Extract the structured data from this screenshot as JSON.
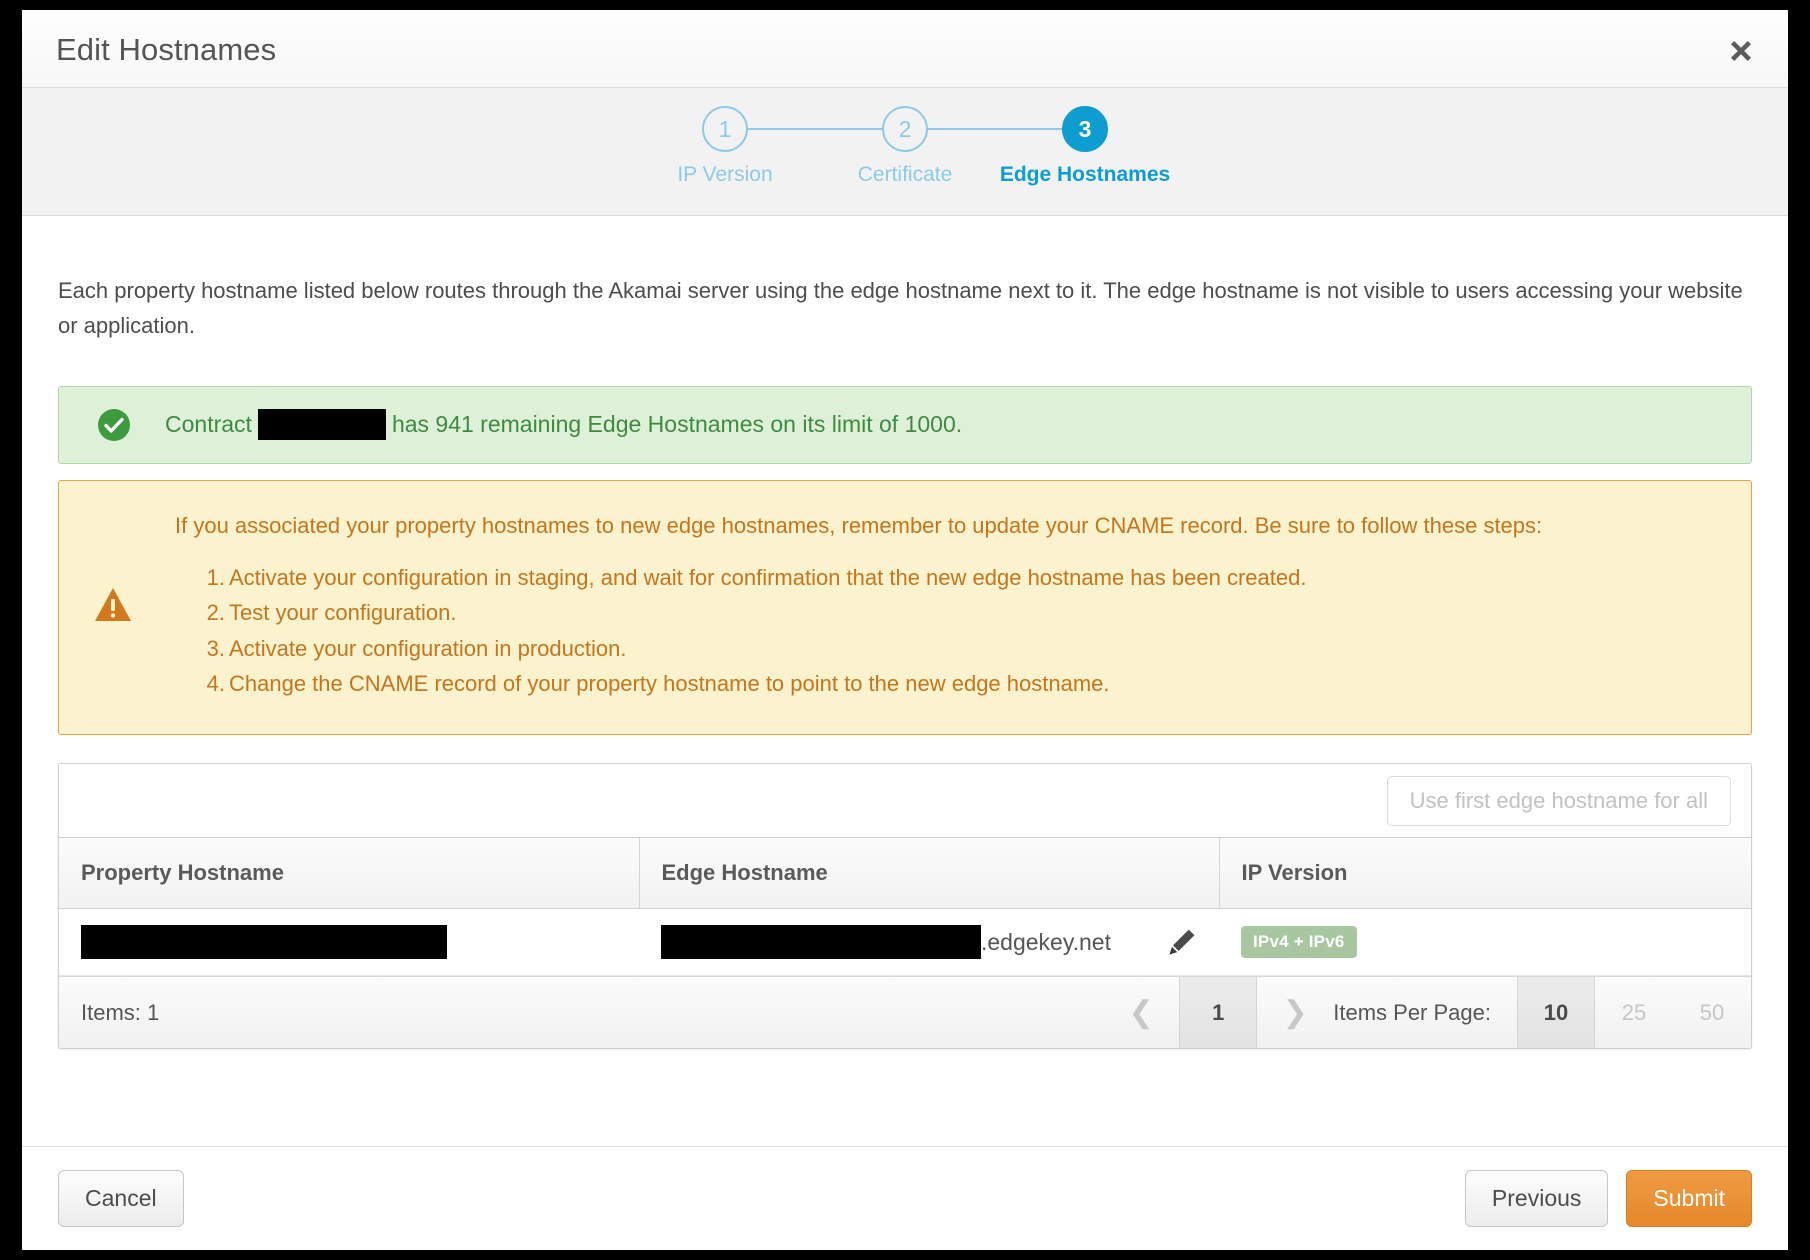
{
  "window": {
    "title": "Edit Hostnames",
    "close_icon": "close-icon"
  },
  "stepper": {
    "steps": [
      {
        "number": "1",
        "label": "IP Version",
        "state": "pending"
      },
      {
        "number": "2",
        "label": "Certificate",
        "state": "pending"
      },
      {
        "number": "3",
        "label": "Edge Hostnames",
        "state": "active"
      }
    ],
    "accent_active": "#0d9dd1",
    "accent_pending": "#8ecae6"
  },
  "main": {
    "intro": "Each property hostname listed below routes through the Akamai server using the edge hostname next to it. The edge hostname is not visible to users accessing your website or application.",
    "success_banner": {
      "icon": "check-circle-icon",
      "text_before": "Contract",
      "redacted": "",
      "text_after": "has 941 remaining Edge Hostnames on its limit of 1000.",
      "bg": "#dff0d8",
      "fg": "#3c8c40"
    },
    "warning_banner": {
      "icon": "warning-triangle-icon",
      "lead": "If you associated your property hostnames to new edge hostnames, remember to update your CNAME record. Be sure to follow these steps:",
      "steps": [
        {
          "num": "1.",
          "text": "Activate your configuration in staging, and wait for confirmation that the new edge hostname has been created."
        },
        {
          "num": "2.",
          "text": "Test your configuration."
        },
        {
          "num": "3.",
          "text": "Activate your configuration in production."
        },
        {
          "num": "4.",
          "text": "Change the CNAME record of your property hostname to point to the new edge hostname."
        }
      ],
      "bg": "#faf3ce",
      "fg": "#c7751c"
    }
  },
  "table": {
    "use_first_button": "Use first edge hostname for all",
    "columns": [
      "Property Hostname",
      "Edge Hostname",
      "IP Version"
    ],
    "rows": [
      {
        "property_hostname": "",
        "edge_hostname_prefix": "",
        "edge_hostname_suffix": ".edgekey.net",
        "edit_icon": "pencil-icon",
        "ip_version": "IPv4 + IPv6",
        "ip_version_color": "#a8c7a1"
      }
    ]
  },
  "pagination": {
    "items_label": "Items: 1",
    "prev_icon": "chevron-left-icon",
    "next_icon": "chevron-right-icon",
    "current_page": "1",
    "items_per_page_label": "Items Per Page:",
    "page_sizes": [
      {
        "value": "10",
        "active": true
      },
      {
        "value": "25",
        "active": false
      },
      {
        "value": "50",
        "active": false
      }
    ]
  },
  "footer": {
    "cancel": "Cancel",
    "previous": "Previous",
    "submit": "Submit",
    "submit_color": "#e58929"
  }
}
